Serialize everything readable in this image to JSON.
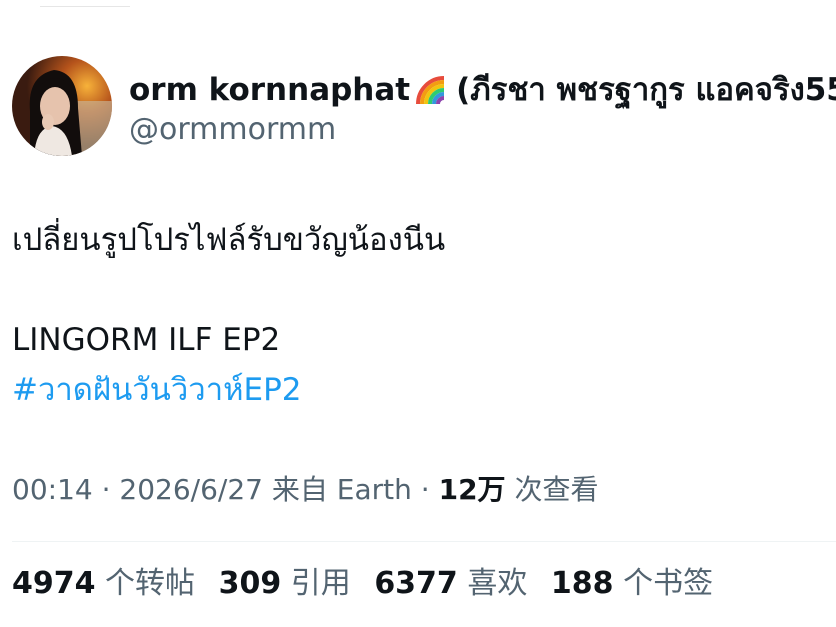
{
  "tweet": {
    "author": {
      "display_name": "orm kornnaphat",
      "display_name_suffix": "(ภีรชา พชรฐากูร แอคจริง555",
      "handle": "@ormmormm",
      "emoji_icon": "rainbow-icon"
    },
    "text_line1": "เปลี่ยนรูปโปรไฟล์รับขวัญน้องนีน",
    "text_line2": "LINGORM ILF EP2",
    "hashtag": "#วาดฝันวันวิวาห์EP2",
    "meta": {
      "time": "00:14",
      "separator": " · ",
      "date": "2026/6/27",
      "source": "来自 Earth",
      "views": "12万",
      "views_label": "次查看"
    },
    "stats": {
      "retweets": "4974",
      "retweets_label": "个转帖",
      "quotes": "309",
      "quotes_label": "引用",
      "likes": "6377",
      "likes_label": "喜欢",
      "bookmarks": "188",
      "bookmarks_label": "个书签"
    }
  },
  "colors": {
    "text": "#0f1419",
    "secondary": "#536471",
    "link": "#1d9bf0",
    "divider": "#eff3f4"
  }
}
